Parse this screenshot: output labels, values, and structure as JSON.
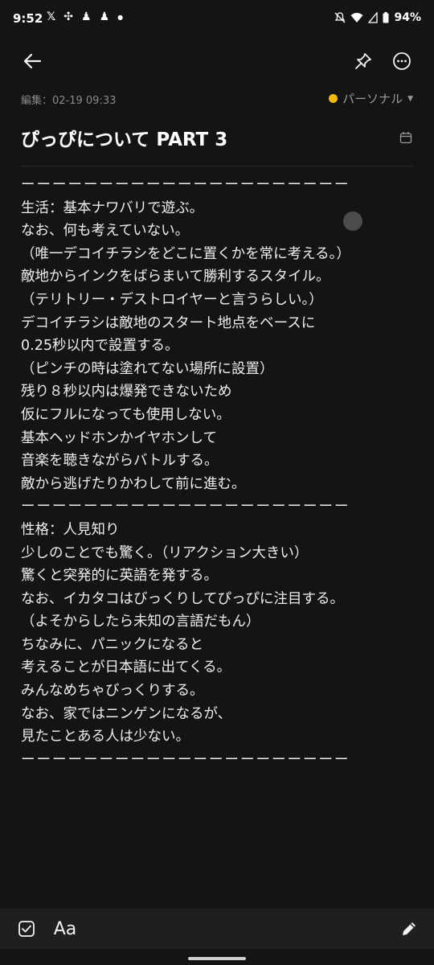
{
  "status_bar": {
    "time": "9:52",
    "battery": "94%",
    "left_icons": [
      "x-icon",
      "pinwheel-icon",
      "figure-icon",
      "figure-icon",
      "dot"
    ],
    "right_icons": [
      "mute-icon",
      "wifi-icon",
      "signal-icon",
      "battery-icon"
    ]
  },
  "meta": {
    "edited": "編集：02-19 09:33",
    "folder": "パーソナル",
    "folder_color": "#f5b800"
  },
  "note": {
    "title": "ぴっぴについて PART 3",
    "lines": [
      "ーーーーーーーーーーーーーーーーーーーーー",
      "生活：基本ナワバリで遊ぶ。",
      "なお、何も考えていない。",
      "（唯一デコイチラシをどこに置くかを常に考える。）",
      "敵地からインクをばらまいて勝利するスタイル。",
      "（テリトリー・デストロイヤーと言うらしい。）",
      "デコイチラシは敵地のスタート地点をベースに",
      "0.25秒以内で設置する。",
      "（ピンチの時は塗れてない場所に設置）",
      "残り８秒以内は爆発できないため",
      "仮にフルになっても使用しない。",
      "基本ヘッドホンかイヤホンして",
      "音楽を聴きながらバトルする。",
      "敵から逃げたりかわして前に進む。",
      "ーーーーーーーーーーーーーーーーーーーーー",
      "性格：人見知り",
      "少しのことでも驚く。（リアクション大きい）",
      "驚くと突発的に英語を発する。",
      "なお、イカタコはびっくりしてぴっぴに注目する。",
      "（よそからしたら未知の言語だもん）",
      "ちなみに、パニックになると",
      "考えることが日本語に出てくる。",
      "みんなめちゃびっくりする。",
      "なお、家ではニンゲンになるが、",
      "見たことある人は少ない。",
      "ーーーーーーーーーーーーーーーーーーーーー"
    ]
  },
  "toolbar": {
    "format_label": "Aa"
  },
  "colors": {
    "background": "#141414",
    "toolbar": "#1f1f1f",
    "text": "#eeeeee"
  }
}
